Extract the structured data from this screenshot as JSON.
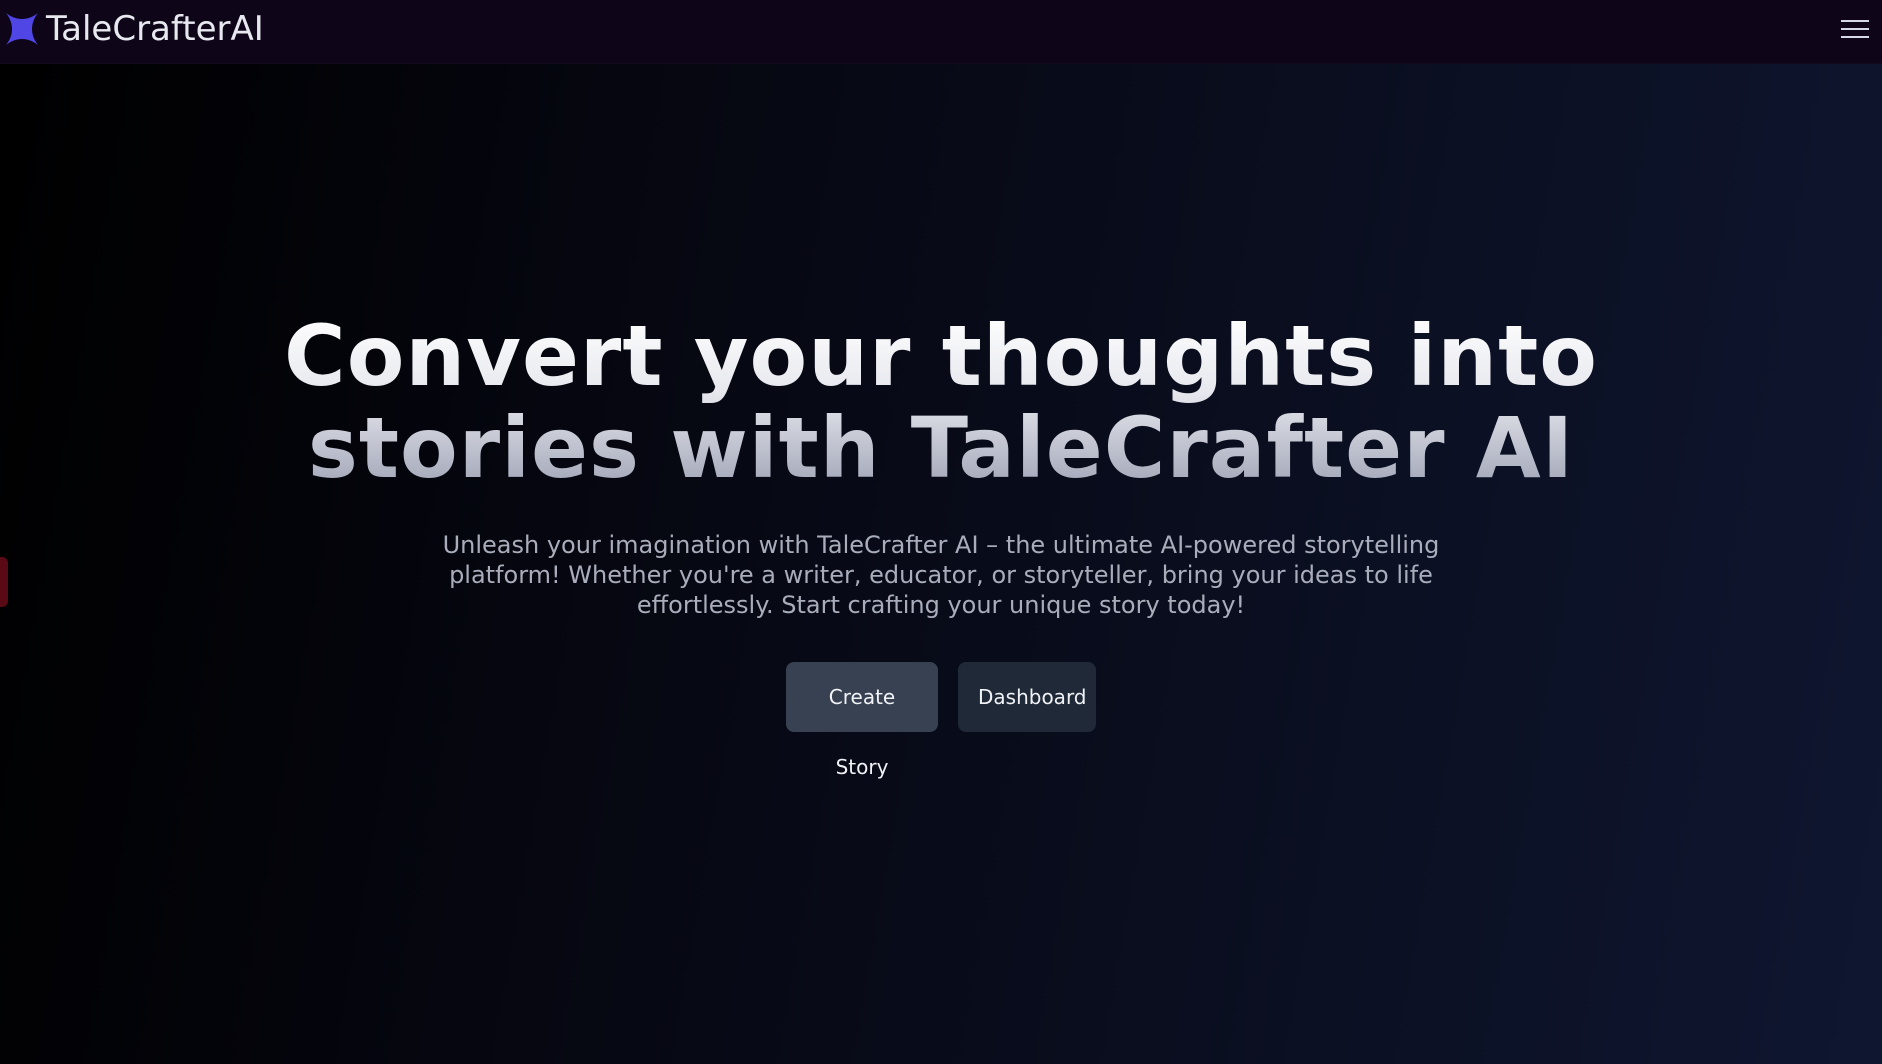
{
  "brand": {
    "name": "TaleCrafterAI",
    "logo_icon": "four-point-star-icon",
    "logo_color": "#4f46e5"
  },
  "nav": {
    "menu_icon": "hamburger-menu-icon"
  },
  "hero": {
    "title_line1": "Convert your thoughts into",
    "title_line2": "stories with TaleCrafter AI",
    "subtitle": "Unleash your imagination with TaleCrafter AI – the ultimate AI-powered storytelling platform! Whether you're a writer, educator, or storyteller, bring your ideas to life effortlessly. Start crafting your unique story today!",
    "buttons": {
      "create_story": "Create Story",
      "dashboard": "Dashboard"
    }
  },
  "colors": {
    "navbar_bg": "#0e0618",
    "primary_button": "#374151",
    "secondary_button": "#1f2937",
    "side_tab": "#5a0a14"
  }
}
